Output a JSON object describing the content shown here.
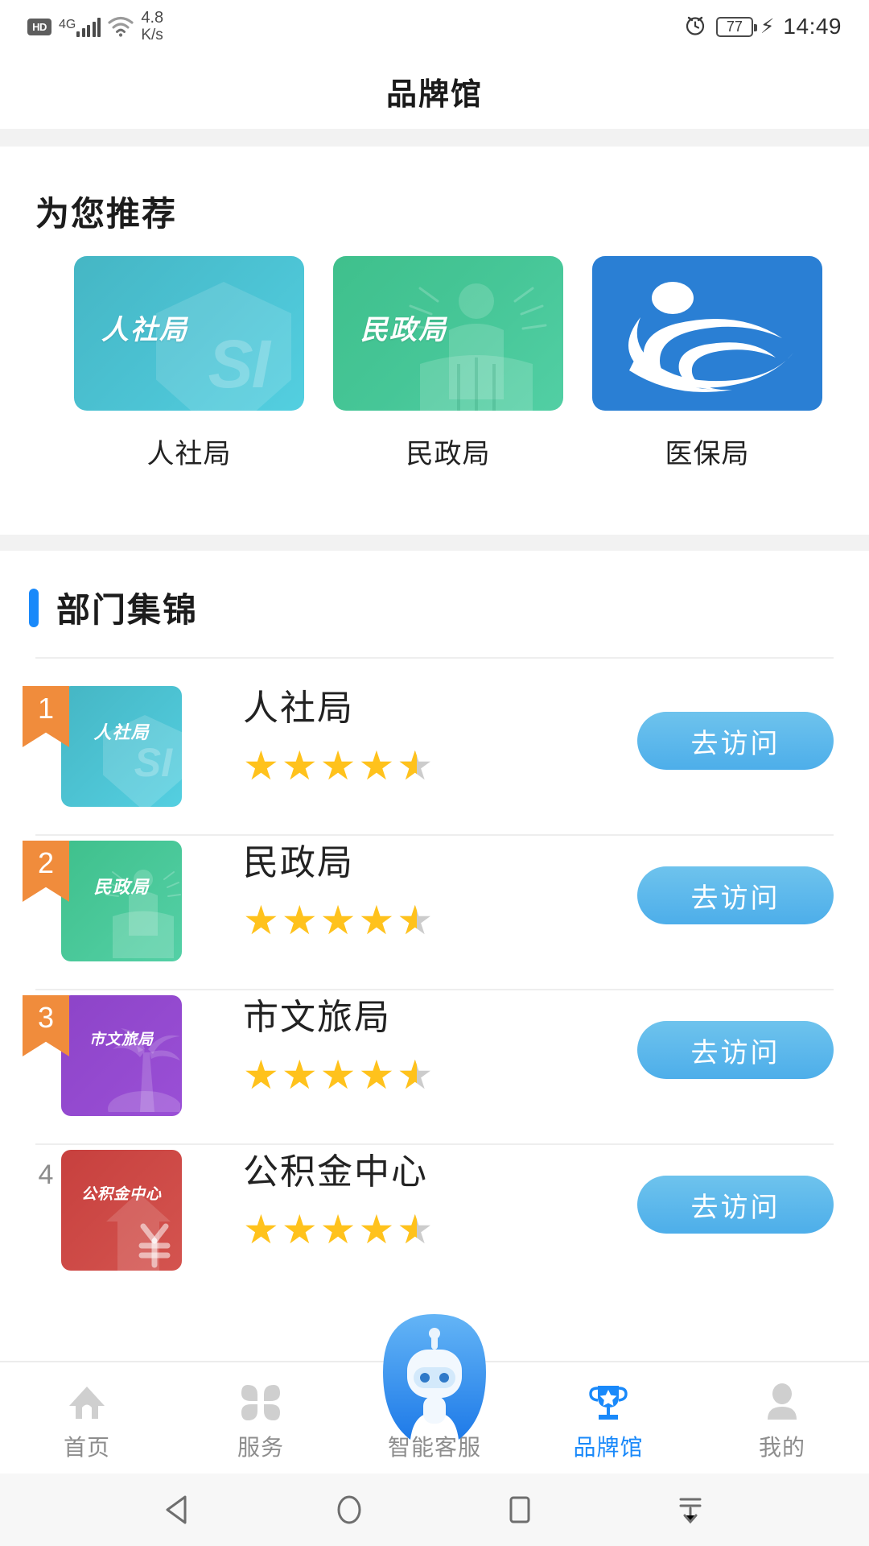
{
  "status_bar": {
    "hd_label": "HD",
    "network_label": "4G",
    "signal_bars": 5,
    "wifi_icon": "wifi-icon",
    "net_speed_value": "4.8",
    "net_speed_unit": "K/s",
    "alarm_icon": "alarm-clock-icon",
    "battery_percent": "77",
    "charging_icon": "charging-bolt-icon",
    "time": "14:49"
  },
  "header": {
    "title": "品牌馆"
  },
  "recommend": {
    "section_title": "为您推荐",
    "cards": [
      {
        "label": "人社局",
        "card_text": "人社局",
        "badge_text": "SI",
        "color": "#4cc3d4",
        "art": "shield-icon"
      },
      {
        "label": "民政局",
        "card_text": "民政局",
        "color": "#46c697",
        "art": "person-book-icon"
      },
      {
        "label": "医保局",
        "card_text": "",
        "color": "#2a7fd4",
        "art": "swirl-wave-icon"
      }
    ]
  },
  "departments": {
    "section_title": "部门集锦",
    "visit_label": "去访问",
    "star_full": "★",
    "rows": [
      {
        "rank": "1",
        "rank_highlight": true,
        "name": "人社局",
        "thumb_text": "人社局",
        "thumb_badge": "SI",
        "rating": 4.5,
        "color": "#45b6c4"
      },
      {
        "rank": "2",
        "rank_highlight": true,
        "name": "民政局",
        "thumb_text": "民政局",
        "rating": 4.5,
        "color": "#3fc08c"
      },
      {
        "rank": "3",
        "rank_highlight": true,
        "name": "市文旅局",
        "thumb_text": "市文旅局",
        "rating": 4.5,
        "color": "#8d44c8"
      },
      {
        "rank": "4",
        "rank_highlight": false,
        "name": "公积金中心",
        "thumb_text": "公积金中心",
        "rating": 4.5,
        "color": "#c7403e"
      }
    ]
  },
  "tabbar": {
    "active_color": "#1989fa",
    "inactive_color": "#8d8d8d",
    "items": [
      {
        "label": "首页",
        "icon": "home-icon",
        "active": false
      },
      {
        "label": "服务",
        "icon": "grid-services-icon",
        "active": false
      },
      {
        "label": "智能客服",
        "icon": "robot-assistant-icon",
        "active": false
      },
      {
        "label": "品牌馆",
        "icon": "trophy-icon",
        "active": true
      },
      {
        "label": "我的",
        "icon": "person-icon",
        "active": false
      }
    ]
  },
  "system_nav": {
    "back_icon": "back-triangle-icon",
    "home_icon": "home-circle-icon",
    "recents_icon": "recents-square-icon",
    "notifications_icon": "pull-down-notifications-icon"
  }
}
